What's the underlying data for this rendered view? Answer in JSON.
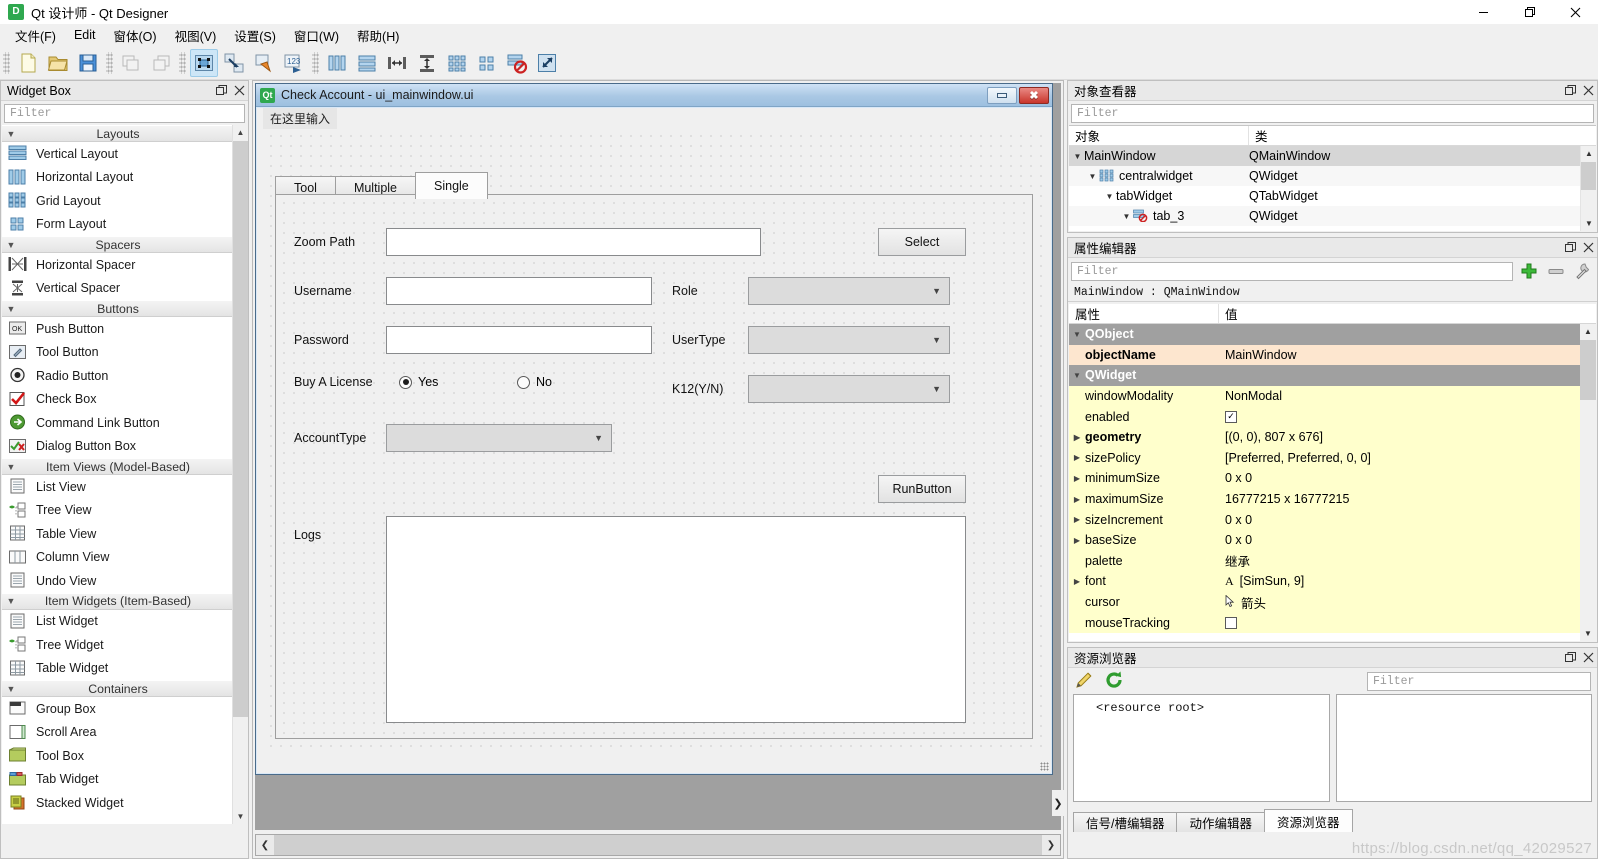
{
  "app": {
    "title": "Qt 设计师 - Qt Designer",
    "icon": "qt-logo-icon",
    "window_controls": {
      "minimize": "minimize-icon",
      "maximize": "maximize-icon",
      "close": "close-icon"
    }
  },
  "menubar": {
    "items": [
      {
        "label": "文件(F)",
        "name": "menu-file"
      },
      {
        "label": "Edit",
        "name": "menu-edit"
      },
      {
        "label": "窗体(O)",
        "name": "menu-form"
      },
      {
        "label": "视图(V)",
        "name": "menu-view"
      },
      {
        "label": "设置(S)",
        "name": "menu-settings"
      },
      {
        "label": "窗口(W)",
        "name": "menu-window"
      },
      {
        "label": "帮助(H)",
        "name": "menu-help"
      }
    ]
  },
  "toolbar": {
    "groups": [
      {
        "buttons": [
          {
            "name": "new-form-icon",
            "tip": "新建"
          },
          {
            "name": "open-form-icon",
            "tip": "打开"
          },
          {
            "name": "save-form-icon",
            "tip": "保存"
          }
        ]
      },
      {
        "buttons": [
          {
            "name": "undo-icon",
            "tip": "撤销"
          },
          {
            "name": "redo-icon",
            "tip": "重做"
          }
        ]
      },
      {
        "buttons": [
          {
            "name": "edit-widgets-icon",
            "tip": "编辑控件",
            "active": true
          },
          {
            "name": "edit-signals-slots-icon",
            "tip": "编辑信号/槽"
          },
          {
            "name": "edit-buddies-icon",
            "tip": "编辑伙伴"
          },
          {
            "name": "edit-tab-order-icon",
            "tip": "编辑Tab顺序"
          }
        ]
      },
      {
        "buttons": [
          {
            "name": "layout-horizontally-icon",
            "tip": "水平布局"
          },
          {
            "name": "layout-vertically-icon",
            "tip": "垂直布局"
          },
          {
            "name": "layout-splitter-horizontal-icon",
            "tip": "水平分裂器布局"
          },
          {
            "name": "layout-splitter-vertical-icon",
            "tip": "垂直分裂器布局"
          },
          {
            "name": "layout-grid-icon",
            "tip": "栅格布局"
          },
          {
            "name": "layout-form-icon",
            "tip": "表单布局"
          },
          {
            "name": "break-layout-icon",
            "tip": "打破布局"
          },
          {
            "name": "adjust-size-icon",
            "tip": "调整大小"
          }
        ]
      }
    ]
  },
  "widget_box": {
    "title": "Widget Box",
    "float_icon": "float-icon",
    "close_icon": "close-icon",
    "filter_placeholder": "Filter",
    "groups": [
      {
        "title": "Layouts",
        "collapsed": false,
        "items": [
          {
            "label": "Vertical Layout",
            "icon": "vertical-layout-icon"
          },
          {
            "label": "Horizontal Layout",
            "icon": "horizontal-layout-icon"
          },
          {
            "label": "Grid Layout",
            "icon": "grid-layout-icon"
          },
          {
            "label": "Form Layout",
            "icon": "form-layout-icon"
          }
        ]
      },
      {
        "title": "Spacers",
        "collapsed": false,
        "items": [
          {
            "label": "Horizontal Spacer",
            "icon": "horizontal-spacer-icon"
          },
          {
            "label": "Vertical Spacer",
            "icon": "vertical-spacer-icon"
          }
        ]
      },
      {
        "title": "Buttons",
        "collapsed": false,
        "items": [
          {
            "label": "Push Button",
            "icon": "push-button-icon"
          },
          {
            "label": "Tool Button",
            "icon": "tool-button-icon"
          },
          {
            "label": "Radio Button",
            "icon": "radio-button-icon"
          },
          {
            "label": "Check Box",
            "icon": "check-box-icon"
          },
          {
            "label": "Command Link Button",
            "icon": "command-link-button-icon"
          },
          {
            "label": "Dialog Button Box",
            "icon": "dialog-button-box-icon"
          }
        ]
      },
      {
        "title": "Item Views (Model-Based)",
        "collapsed": false,
        "items": [
          {
            "label": "List View",
            "icon": "list-view-icon"
          },
          {
            "label": "Tree View",
            "icon": "tree-view-icon"
          },
          {
            "label": "Table View",
            "icon": "table-view-icon"
          },
          {
            "label": "Column View",
            "icon": "column-view-icon"
          },
          {
            "label": "Undo View",
            "icon": "undo-view-icon"
          }
        ]
      },
      {
        "title": "Item Widgets (Item-Based)",
        "collapsed": false,
        "items": [
          {
            "label": "List Widget",
            "icon": "list-widget-icon"
          },
          {
            "label": "Tree Widget",
            "icon": "tree-widget-icon"
          },
          {
            "label": "Table Widget",
            "icon": "table-widget-icon"
          }
        ]
      },
      {
        "title": "Containers",
        "collapsed": false,
        "items": [
          {
            "label": "Group Box",
            "icon": "group-box-icon"
          },
          {
            "label": "Scroll Area",
            "icon": "scroll-area-icon"
          },
          {
            "label": "Tool Box",
            "icon": "tool-box-icon"
          },
          {
            "label": "Tab Widget",
            "icon": "tab-widget-icon"
          },
          {
            "label": "Stacked Widget",
            "icon": "stacked-widget-icon"
          }
        ]
      }
    ]
  },
  "form_window": {
    "title": "Check Account - ui_mainwindow.ui",
    "icon": "qt-logo-icon",
    "minimize_label": "minimize-icon",
    "close_label": "✖",
    "menu_hint": "在这里输入",
    "tabs": [
      {
        "label": "Tool",
        "selected": false
      },
      {
        "label": "Multiple",
        "selected": false
      },
      {
        "label": "Single",
        "selected": true
      }
    ],
    "fields": {
      "zoom_path_label": "Zoom Path",
      "zoom_path_value": "",
      "select_button": "Select",
      "username_label": "Username",
      "username_value": "",
      "role_label": "Role",
      "role_value": "",
      "password_label": "Password",
      "password_value": "",
      "usertype_label": "UserType",
      "usertype_value": "",
      "buy_license_label": "Buy A License",
      "radio_yes_label": "Yes",
      "radio_no_label": "No",
      "radio_selected": "Yes",
      "k12_label": "K12(Y/N)",
      "k12_value": "",
      "account_type_label": "AccountType",
      "account_type_value": "",
      "run_button": "RunButton",
      "logs_label": "Logs",
      "logs_value": ""
    }
  },
  "object_inspector": {
    "title": "对象查看器",
    "float_icon": "float-icon",
    "close_icon": "close-icon",
    "filter_placeholder": "Filter",
    "columns": [
      "对象",
      "类"
    ],
    "rows": [
      {
        "name": "MainWindow",
        "class": "QMainWindow",
        "depth": 0,
        "expanded": true,
        "icon": "",
        "selected": true
      },
      {
        "name": "centralwidget",
        "class": "QWidget",
        "depth": 1,
        "expanded": true,
        "icon": "grid-layout-icon",
        "selected": false
      },
      {
        "name": "tabWidget",
        "class": "QTabWidget",
        "depth": 2,
        "expanded": true,
        "icon": "",
        "selected": false
      },
      {
        "name": "tab_3",
        "class": "QWidget",
        "depth": 3,
        "expanded": true,
        "icon": "break-layout-icon",
        "selected": false
      }
    ]
  },
  "property_editor": {
    "title": "属性编辑器",
    "float_icon": "float-icon",
    "close_icon": "close-icon",
    "filter_placeholder": "Filter",
    "add_icon": "add-property-icon",
    "remove_icon": "remove-property-icon",
    "configure_icon": "configure-icon",
    "object_line": "MainWindow : QMainWindow",
    "columns": [
      "属性",
      "值"
    ],
    "rows": [
      {
        "kind": "group",
        "key": "QObject",
        "value": ""
      },
      {
        "kind": "highlight",
        "key": "objectName",
        "value": "MainWindow",
        "expandable": false
      },
      {
        "kind": "group",
        "key": "QWidget",
        "value": ""
      },
      {
        "kind": "normal",
        "key": "windowModality",
        "value": "NonModal",
        "expandable": false
      },
      {
        "kind": "normal",
        "key": "enabled",
        "value": "",
        "checkbox": true,
        "checked": true,
        "expandable": false
      },
      {
        "kind": "bold",
        "key": "geometry",
        "value": "[(0, 0), 807 x 676]",
        "expandable": true
      },
      {
        "kind": "normal",
        "key": "sizePolicy",
        "value": "[Preferred, Preferred, 0, 0]",
        "expandable": true
      },
      {
        "kind": "normal",
        "key": "minimumSize",
        "value": "0 x 0",
        "expandable": true
      },
      {
        "kind": "normal",
        "key": "maximumSize",
        "value": "16777215 x 16777215",
        "expandable": true
      },
      {
        "kind": "normal",
        "key": "sizeIncrement",
        "value": "0 x 0",
        "expandable": true
      },
      {
        "kind": "normal",
        "key": "baseSize",
        "value": "0 x 0",
        "expandable": true
      },
      {
        "kind": "normal",
        "key": "palette",
        "value": "继承",
        "expandable": false
      },
      {
        "kind": "normal",
        "key": "font",
        "value": "[SimSun, 9]",
        "expandable": true,
        "prefix_icon": "font-icon"
      },
      {
        "kind": "normal",
        "key": "cursor",
        "value": "箭头",
        "expandable": false,
        "prefix_icon": "cursor-arrow-icon"
      },
      {
        "kind": "normal",
        "key": "mouseTracking",
        "value": "",
        "checkbox": true,
        "checked": false,
        "expandable": false
      }
    ]
  },
  "resource_browser": {
    "title": "资源浏览器",
    "float_icon": "float-icon",
    "close_icon": "close-icon",
    "edit_icon": "pencil-edit-icon",
    "reload_icon": "reload-icon",
    "filter_placeholder": "Filter",
    "tree_root": "<resource root>",
    "tabs": [
      {
        "label": "信号/槽编辑器",
        "selected": false
      },
      {
        "label": "动作编辑器",
        "selected": false
      },
      {
        "label": "资源浏览器",
        "selected": true
      }
    ]
  },
  "watermark": "https://blog.csdn.net/qq_42029527",
  "colors": {
    "accent_blue": "#cde6f7",
    "title_blue": "#aac8e4",
    "close_red": "#c9352c",
    "property_yellow": "#ffffcc",
    "property_orange": "#fde6cf",
    "group_gray": "#a0a0a0"
  }
}
